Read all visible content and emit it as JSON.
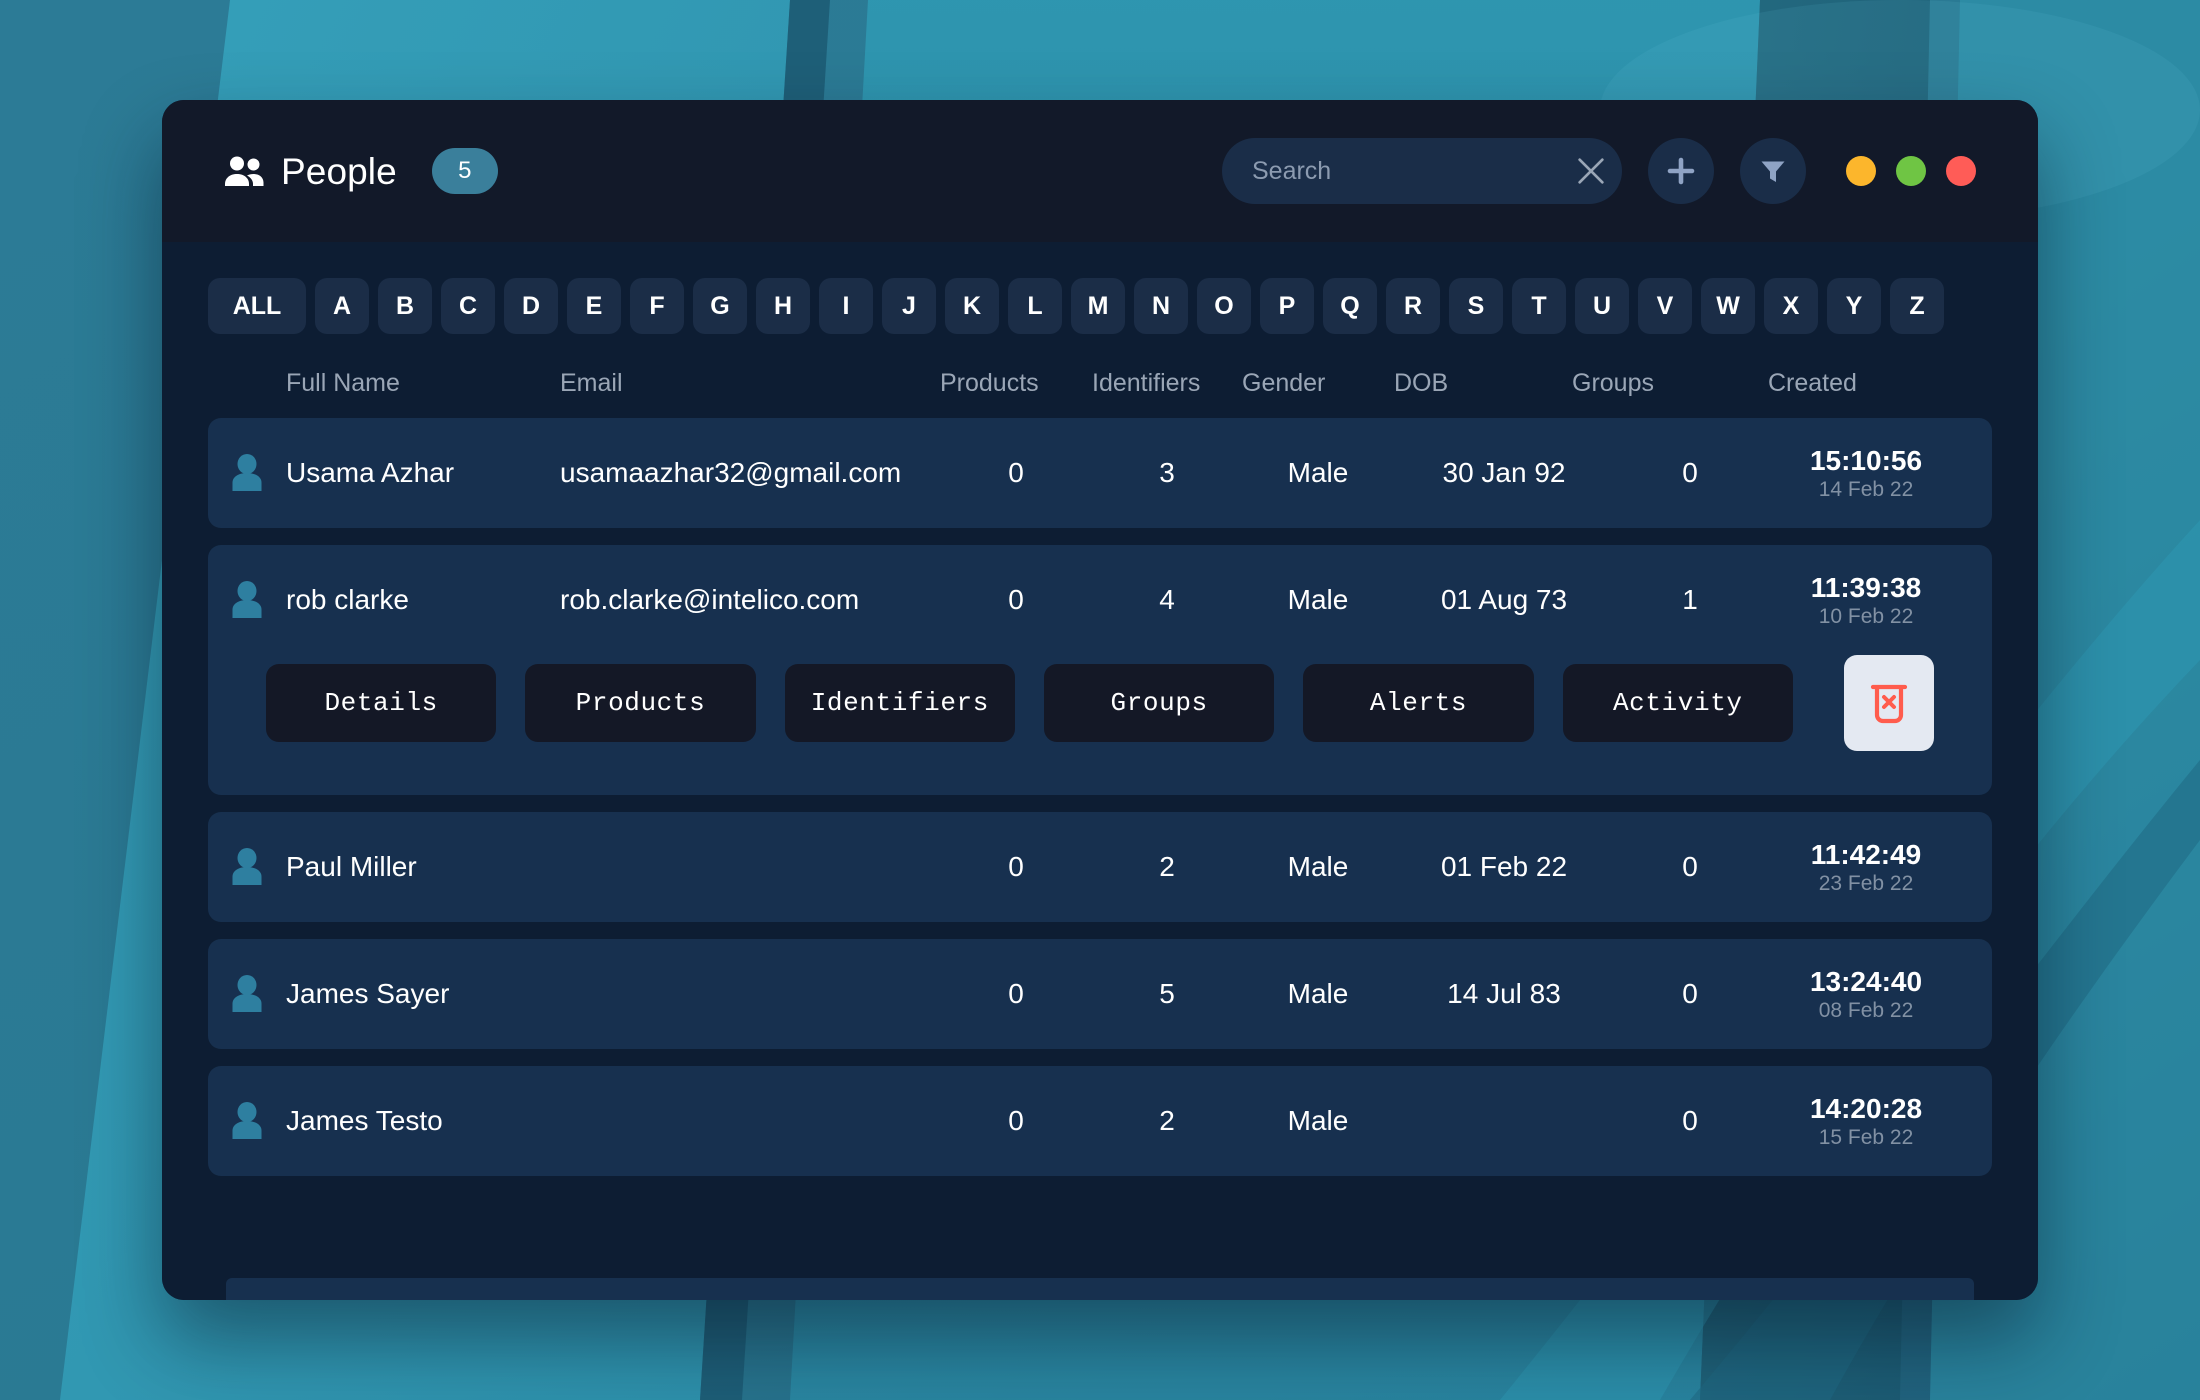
{
  "window": {
    "title": "People",
    "icon": "people-icon",
    "count_badge": "5",
    "accent_color": "#3a7f9b",
    "header_bg": "#121929",
    "body_bg": "#0d1d33",
    "row_bg": "#17304f"
  },
  "search": {
    "placeholder": "Search",
    "value": "",
    "clear_icon": "close-x-icon"
  },
  "header_actions": [
    {
      "name": "add-person-button",
      "icon": "plus-icon"
    },
    {
      "name": "filter-button",
      "icon": "funnel-icon"
    }
  ],
  "traffic_lights": [
    {
      "name": "minimize-dot",
      "color": "#fcb62c"
    },
    {
      "name": "maximize-dot",
      "color": "#6fc544"
    },
    {
      "name": "close-dot",
      "color": "#ff5c57"
    }
  ],
  "alphabet_filter": {
    "selected": "ALL",
    "items": [
      "ALL",
      "A",
      "B",
      "C",
      "D",
      "E",
      "F",
      "G",
      "H",
      "I",
      "J",
      "K",
      "L",
      "M",
      "N",
      "O",
      "P",
      "Q",
      "R",
      "S",
      "T",
      "U",
      "V",
      "W",
      "X",
      "Y",
      "Z"
    ]
  },
  "table": {
    "columns": [
      "Full Name",
      "Email",
      "Products",
      "Identifiers",
      "Gender",
      "DOB",
      "Groups",
      "Created"
    ],
    "rows": [
      {
        "full_name": "Usama Azhar",
        "email": "usamaazhar32@gmail.com",
        "products": "0",
        "identifiers": "3",
        "gender": "Male",
        "dob": "30 Jan 92",
        "groups": "0",
        "created_time": "15:10:56",
        "created_date": "14 Feb 22",
        "expanded": false
      },
      {
        "full_name": "rob clarke",
        "email": "rob.clarke@intelico.com",
        "products": "0",
        "identifiers": "4",
        "gender": "Male",
        "dob": "01 Aug 73",
        "groups": "1",
        "created_time": "11:39:38",
        "created_date": "10 Feb 22",
        "expanded": true
      },
      {
        "full_name": "Paul Miller",
        "email": "",
        "products": "0",
        "identifiers": "2",
        "gender": "Male",
        "dob": "01 Feb 22",
        "groups": "0",
        "created_time": "11:42:49",
        "created_date": "23 Feb 22",
        "expanded": false
      },
      {
        "full_name": "James Sayer",
        "email": "",
        "products": "0",
        "identifiers": "5",
        "gender": "Male",
        "dob": "14 Jul 83",
        "groups": "0",
        "created_time": "13:24:40",
        "created_date": "08 Feb 22",
        "expanded": false
      },
      {
        "full_name": "James Testo",
        "email": "",
        "products": "0",
        "identifiers": "2",
        "gender": "Male",
        "dob": "",
        "groups": "0",
        "created_time": "14:20:28",
        "created_date": "15 Feb 22",
        "expanded": false
      }
    ]
  },
  "row_actions": {
    "buttons": [
      "Details",
      "Products",
      "Identifiers",
      "Groups",
      "Alerts",
      "Activity"
    ],
    "delete": {
      "name": "delete-person-button",
      "icon": "trash-x-icon",
      "color": "#ff5c4d"
    }
  }
}
